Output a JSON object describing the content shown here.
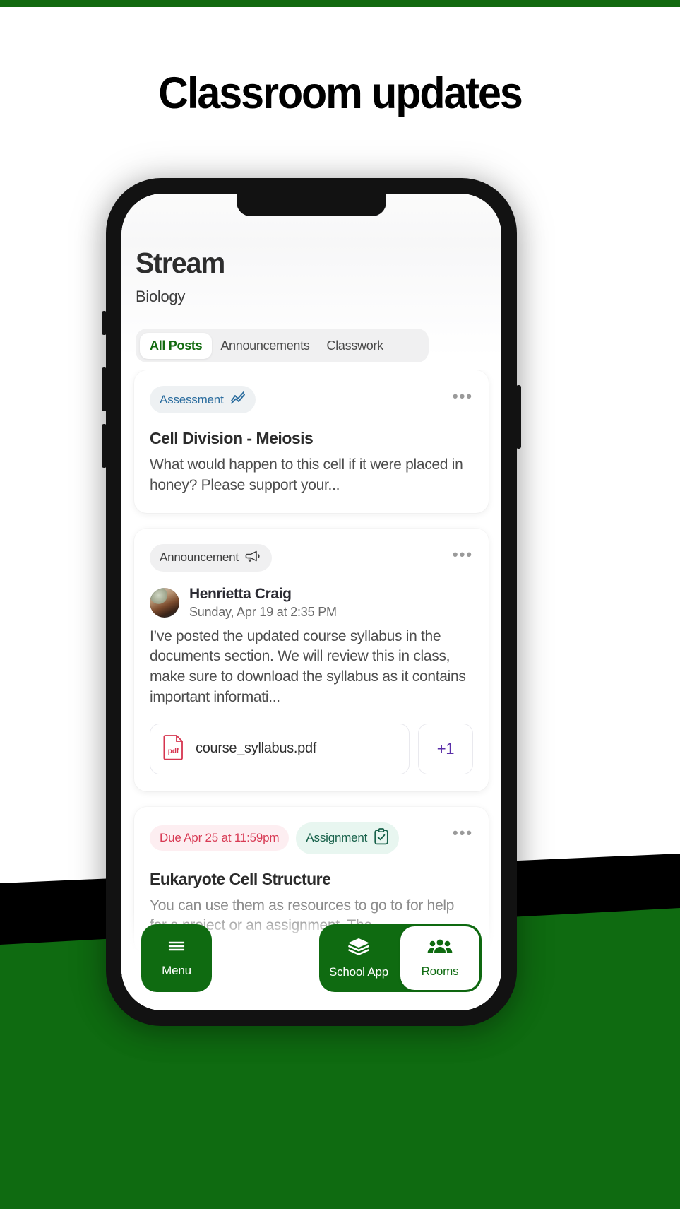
{
  "page": {
    "headline": "Classroom updates"
  },
  "app": {
    "title": "Stream",
    "course": "Biology",
    "tabs": [
      {
        "label": "All Posts",
        "active": true
      },
      {
        "label": "Announcements",
        "active": false
      },
      {
        "label": "Classwork",
        "active": false
      }
    ],
    "overflow_menu": "•••"
  },
  "posts": [
    {
      "badge": "Assessment",
      "badge_icon": "line-chart-icon",
      "title": "Cell Division - Meiosis",
      "body": "What would happen to this cell if it were placed in honey? Please support your..."
    },
    {
      "badge": "Announcement",
      "badge_icon": "megaphone-icon",
      "author": "Henrietta Craig",
      "timestamp": "Sunday, Apr 19 at 2:35 PM",
      "body": "I’ve posted the updated course syllabus in the documents section. We will review this in class, make sure to download the syllabus as it contains important informati...",
      "attachment": {
        "file_name": "course_syllabus.pdf",
        "file_type_label": "pdf",
        "more_count": "+1"
      }
    },
    {
      "due": "Due Apr 25 at 11:59pm",
      "badge": "Assignment",
      "badge_icon": "clipboard-check-icon",
      "title": "Eukaryote Cell Structure",
      "body": "You can use them as resources to go to for help for a project or an assignment. The"
    }
  ],
  "bottom_nav": {
    "menu": {
      "label": "Menu",
      "icon": "hamburger-icon"
    },
    "items": [
      {
        "label": "School App",
        "icon": "layers-icon",
        "active": false
      },
      {
        "label": "Rooms",
        "icon": "people-icon",
        "active": true
      }
    ]
  },
  "colors": {
    "brand_green": "#0f6b11",
    "accent_blue": "#2a6c9e",
    "accent_teal": "#17614a",
    "accent_red": "#d83a54",
    "accent_purple": "#5a2fa8",
    "pdf_red": "#d6344f"
  }
}
